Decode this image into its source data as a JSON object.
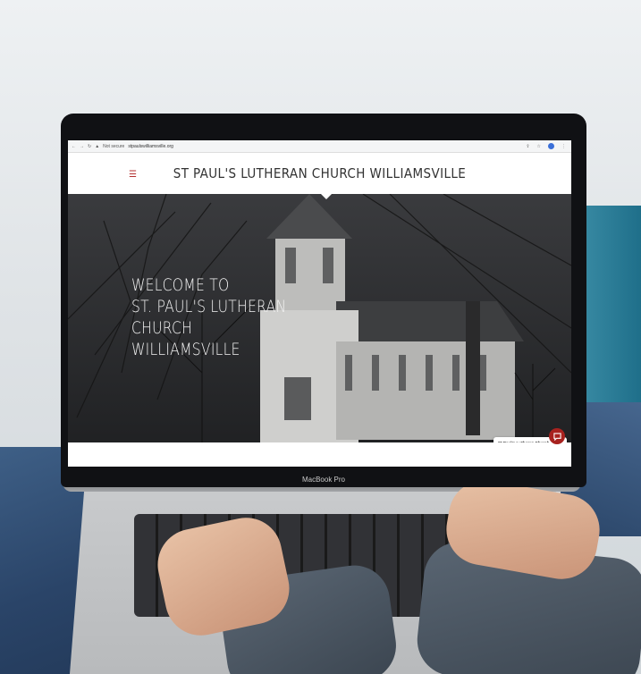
{
  "browser": {
    "security_label": "Not secure",
    "url": "stpaulswilliamsville.org",
    "nav_icons": [
      "back-icon",
      "forward-icon",
      "reload-icon"
    ],
    "right_icons": [
      "share-icon",
      "star-icon",
      "profile-icon",
      "menu-icon"
    ]
  },
  "site": {
    "menu_icon": "☰",
    "title": "ST PAUL'S LUTHERAN CHURCH WILLIAMSVILLE",
    "hero_lines": [
      "WELCOME TO",
      "ST. PAUL'S LUTHERAN",
      "CHURCH",
      "WILLIAMSVILLE"
    ]
  },
  "chat": {
    "sender": "St Paul's Lutheran Church Williamsville",
    "message": "Let me know if you have any questions!",
    "close_icon": "˅",
    "button_icon": "chat-bubble-icon"
  },
  "device": {
    "label": "MacBook Pro"
  },
  "colors": {
    "accent": "#a8221f",
    "header_text": "#333333",
    "hero_bg": "#2a2b2d"
  }
}
